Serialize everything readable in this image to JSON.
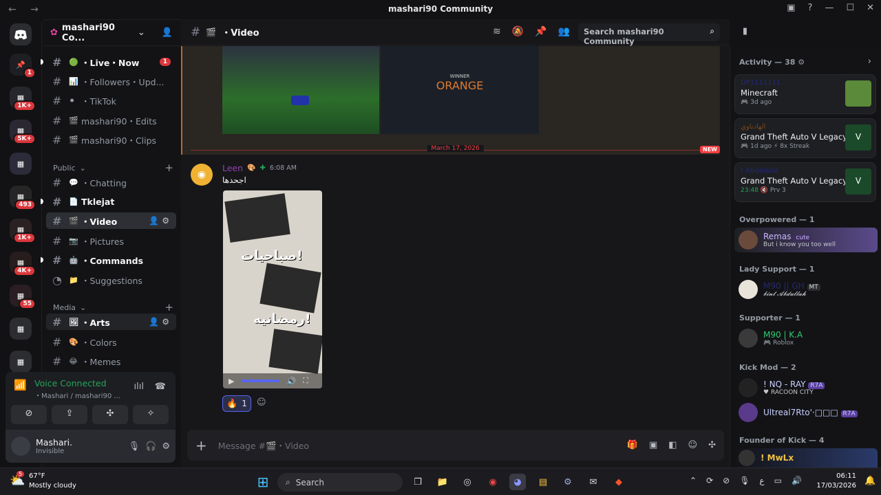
{
  "titlebar": {
    "title": "mashari90 Community"
  },
  "guild_badges": [
    "1",
    "1K+",
    "5K+",
    "493",
    "1K+",
    "4K+",
    "55"
  ],
  "server": {
    "name": "mashari90 Co..."
  },
  "channels_top": [
    {
      "name": "・Live・Now",
      "emoji": "🟢",
      "unread": true,
      "mention": "1"
    },
    {
      "name": "・Followers・Upd...",
      "emoji": "📊",
      "unread": false
    },
    {
      "name": "・TikTok",
      "emoji": "⚫",
      "unread": false
    },
    {
      "name": "mashari90・Edits",
      "emoji": "🎬",
      "unread": false
    },
    {
      "name": "mashari90・Clips",
      "emoji": "🎬",
      "unread": false
    }
  ],
  "categories": {
    "public": "Public",
    "media": "Media"
  },
  "channels_public": [
    {
      "name": "・Chatting",
      "emoji": "💬",
      "unread": false
    },
    {
      "name": "Tklejat",
      "emoji": "📄",
      "unread": true
    },
    {
      "name": "・Video",
      "emoji": "🎬",
      "active": true
    },
    {
      "name": "・Pictures",
      "emoji": "📷",
      "unread": false
    },
    {
      "name": "・Commands",
      "emoji": "🤖",
      "unread": true
    },
    {
      "name": "・Suggestions",
      "emoji": "📁",
      "unread": false
    }
  ],
  "channels_media": [
    {
      "name": "・Arts",
      "emoji": "🖼",
      "active": true
    },
    {
      "name": "・Colors",
      "emoji": "🎨",
      "unread": false
    },
    {
      "name": "・Memes",
      "emoji": "😂",
      "unread": false
    }
  ],
  "voice": {
    "status": "Voice Connected",
    "location": "・Mashari / mashari90 ..."
  },
  "user": {
    "name": "Mashari.",
    "status": "Invisible"
  },
  "channel_header": {
    "name": "・Video",
    "search_placeholder": "Search mashari90 Community"
  },
  "embed": {
    "winner_label": "WINNER",
    "winner_team": "ORANGE"
  },
  "divider": {
    "date": "March 17, 2026",
    "new_label": "NEW"
  },
  "message": {
    "author": "Leen",
    "time": "6:08 AM",
    "text": "اجحدها",
    "image_lines": [
      "صباحيات!",
      "رمضانيه!"
    ],
    "reaction_count": "1"
  },
  "composer": {
    "placeholder": "Message #🎬・Video"
  },
  "members": {
    "activity_header": "Activity — 38",
    "activity": [
      {
        "name": "DP1111111",
        "game": "Minecraft",
        "meta": "3d ago"
      },
      {
        "name": "الهادناوي",
        "game": "Grand Theft Auto V Legacy",
        "meta": "1d ago",
        "extra": "8x Streak"
      },
      {
        "name": "! Abdalaziz",
        "game": "Grand Theft Auto V Legacy",
        "meta": "23:48",
        "extra": "Prv 3"
      }
    ],
    "groups": [
      {
        "title": "Overpowered — 1",
        "members": [
          {
            "name": "Remas",
            "tag": "cute",
            "status": "But i know you too well"
          }
        ]
      },
      {
        "title": "Lady Support — 1",
        "members": [
          {
            "name": "M90 || GH",
            "tag": "MT",
            "status": "𝓫𝓲𝓷𝓽 𝓐𝓫𝓭𝓾𝓵𝓵𝓪𝓱"
          }
        ]
      },
      {
        "title": "Supporter — 1",
        "members": [
          {
            "name": "M90 | K.A",
            "status": "Roblox"
          }
        ]
      },
      {
        "title": "Kick Mod — 2",
        "members": [
          {
            "name": "! NQ - RAY",
            "tag": "R7A",
            "status": "RACOON CITY"
          },
          {
            "name": "Ultreal7Rto'·□□□",
            "tag": "R7A",
            "status": ""
          }
        ]
      },
      {
        "title": "Founder of Kick — 4",
        "members": [
          {
            "name": "! MwLx",
            "status": ""
          }
        ]
      }
    ]
  },
  "taskbar": {
    "weather_temp": "67°F",
    "weather_desc": "Mostly cloudy",
    "search_label": "Search",
    "time": "06:11",
    "date": "17/03/2026",
    "lang": "ع",
    "weather_badge": "5"
  }
}
